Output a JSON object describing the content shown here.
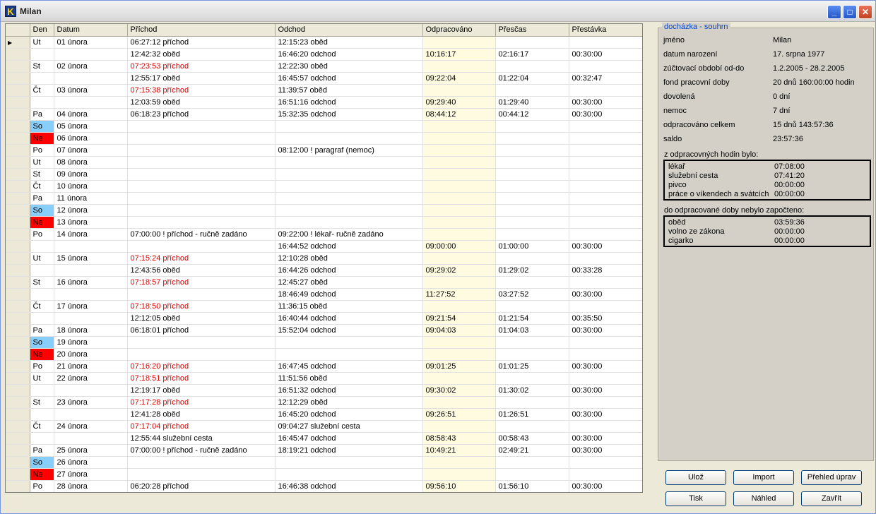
{
  "window": {
    "title": "Milan",
    "app_icon": "K",
    "minimize": "_",
    "maximize": "□",
    "close": "✕"
  },
  "grid": {
    "headers": [
      "Den",
      "Datum",
      "Příchod",
      "Odchod",
      "Odpracováno",
      "Přesčas",
      "Přestávka"
    ],
    "rows": [
      {
        "den": "Ut",
        "datum": "01 února",
        "prichod": "06:27:12 příchod",
        "odchod": "12:15:23 oběd",
        "odp": "",
        "presc": "",
        "prest": "",
        "red": false,
        "current": true
      },
      {
        "den": "",
        "datum": "",
        "prichod": "12:42:32 oběd",
        "odchod": "16:46:20 odchod",
        "odp": "10:16:17",
        "presc": "02:16:17",
        "prest": "00:30:00",
        "red": false
      },
      {
        "den": "St",
        "datum": "02 února",
        "prichod": "07:23:53 příchod",
        "odchod": "12:22:30 oběd",
        "odp": "",
        "presc": "",
        "prest": "",
        "red": true
      },
      {
        "den": "",
        "datum": "",
        "prichod": "12:55:17 oběd",
        "odchod": "16:45:57 odchod",
        "odp": "09:22:04",
        "presc": "01:22:04",
        "prest": "00:32:47",
        "red": false
      },
      {
        "den": "Čt",
        "datum": "03 února",
        "prichod": "07:15:38 příchod",
        "odchod": "11:39:57 oběd",
        "odp": "",
        "presc": "",
        "prest": "",
        "red": true
      },
      {
        "den": "",
        "datum": "",
        "prichod": "12:03:59 oběd",
        "odchod": "16:51:16 odchod",
        "odp": "09:29:40",
        "presc": "01:29:40",
        "prest": "00:30:00",
        "red": false
      },
      {
        "den": "Pa",
        "datum": "04 února",
        "prichod": "06:18:23 příchod",
        "odchod": "15:32:35 odchod",
        "odp": "08:44:12",
        "presc": "00:44:12",
        "prest": "00:30:00",
        "red": false
      },
      {
        "den": "So",
        "datum": "05 února",
        "prichod": "",
        "odchod": "",
        "odp": "",
        "presc": "",
        "prest": "",
        "red": false,
        "day": "so"
      },
      {
        "den": "Ne",
        "datum": "06 února",
        "prichod": "",
        "odchod": "",
        "odp": "",
        "presc": "",
        "prest": "",
        "red": false,
        "day": "ne"
      },
      {
        "den": "Po",
        "datum": "07 února",
        "prichod": "",
        "odchod": "08:12:00 ! paragraf (nemoc)",
        "odp": "",
        "presc": "",
        "prest": "",
        "red": false
      },
      {
        "den": "Ut",
        "datum": "08 února",
        "prichod": "",
        "odchod": "",
        "odp": "",
        "presc": "",
        "prest": "",
        "red": false
      },
      {
        "den": "St",
        "datum": "09 února",
        "prichod": "",
        "odchod": "",
        "odp": "",
        "presc": "",
        "prest": "",
        "red": false
      },
      {
        "den": "Čt",
        "datum": "10 února",
        "prichod": "",
        "odchod": "",
        "odp": "",
        "presc": "",
        "prest": "",
        "red": false
      },
      {
        "den": "Pa",
        "datum": "11 února",
        "prichod": "",
        "odchod": "",
        "odp": "",
        "presc": "",
        "prest": "",
        "red": false
      },
      {
        "den": "So",
        "datum": "12 února",
        "prichod": "",
        "odchod": "",
        "odp": "",
        "presc": "",
        "prest": "",
        "red": false,
        "day": "so"
      },
      {
        "den": "Ne",
        "datum": "13 února",
        "prichod": "",
        "odchod": "",
        "odp": "",
        "presc": "",
        "prest": "",
        "red": false,
        "day": "ne"
      },
      {
        "den": "Po",
        "datum": "14 února",
        "prichod": "07:00:00 ! příchod - ručně zadáno",
        "odchod": "09:22:00 ! lékař- ručně zadáno",
        "odp": "",
        "presc": "",
        "prest": "",
        "red": false
      },
      {
        "den": "",
        "datum": "",
        "prichod": "",
        "odchod": "16:44:52 odchod",
        "odp": "09:00:00",
        "presc": "01:00:00",
        "prest": "00:30:00",
        "red": false
      },
      {
        "den": "Ut",
        "datum": "15 února",
        "prichod": "07:15:24 příchod",
        "odchod": "12:10:28 oběd",
        "odp": "",
        "presc": "",
        "prest": "",
        "red": true
      },
      {
        "den": "",
        "datum": "",
        "prichod": "12:43:56 oběd",
        "odchod": "16:44:26 odchod",
        "odp": "09:29:02",
        "presc": "01:29:02",
        "prest": "00:33:28",
        "red": false
      },
      {
        "den": "St",
        "datum": "16 února",
        "prichod": "07:18:57 příchod",
        "odchod": "12:45:27 oběd",
        "odp": "",
        "presc": "",
        "prest": "",
        "red": true
      },
      {
        "den": "",
        "datum": "",
        "prichod": "",
        "odchod": "18:46:49 odchod",
        "odp": "11:27:52",
        "presc": "03:27:52",
        "prest": "00:30:00",
        "red": false
      },
      {
        "den": "Čt",
        "datum": "17 února",
        "prichod": "07:18:50 příchod",
        "odchod": "11:36:15 oběd",
        "odp": "",
        "presc": "",
        "prest": "",
        "red": true
      },
      {
        "den": "",
        "datum": "",
        "prichod": "12:12:05 oběd",
        "odchod": "16:40:44 odchod",
        "odp": "09:21:54",
        "presc": "01:21:54",
        "prest": "00:35:50",
        "red": false
      },
      {
        "den": "Pa",
        "datum": "18 února",
        "prichod": "06:18:01 příchod",
        "odchod": "15:52:04 odchod",
        "odp": "09:04:03",
        "presc": "01:04:03",
        "prest": "00:30:00",
        "red": false
      },
      {
        "den": "So",
        "datum": "19 února",
        "prichod": "",
        "odchod": "",
        "odp": "",
        "presc": "",
        "prest": "",
        "red": false,
        "day": "so"
      },
      {
        "den": "Ne",
        "datum": "20 února",
        "prichod": "",
        "odchod": "",
        "odp": "",
        "presc": "",
        "prest": "",
        "red": false,
        "day": "ne"
      },
      {
        "den": "Po",
        "datum": "21 února",
        "prichod": "07:16:20 příchod",
        "odchod": "16:47:45 odchod",
        "odp": "09:01:25",
        "presc": "01:01:25",
        "prest": "00:30:00",
        "red": true
      },
      {
        "den": "Ut",
        "datum": "22 února",
        "prichod": "07:18:51 příchod",
        "odchod": "11:51:56 oběd",
        "odp": "",
        "presc": "",
        "prest": "",
        "red": true
      },
      {
        "den": "",
        "datum": "",
        "prichod": "12:19:17 oběd",
        "odchod": "16:51:32 odchod",
        "odp": "09:30:02",
        "presc": "01:30:02",
        "prest": "00:30:00",
        "red": false
      },
      {
        "den": "St",
        "datum": "23 února",
        "prichod": "07:17:28 příchod",
        "odchod": "12:12:29 oběd",
        "odp": "",
        "presc": "",
        "prest": "",
        "red": true
      },
      {
        "den": "",
        "datum": "",
        "prichod": "12:41:28 oběd",
        "odchod": "16:45:20 odchod",
        "odp": "09:26:51",
        "presc": "01:26:51",
        "prest": "00:30:00",
        "red": false
      },
      {
        "den": "Čt",
        "datum": "24 února",
        "prichod": "07:17:04 příchod",
        "odchod": "09:04:27 služební cesta",
        "odp": "",
        "presc": "",
        "prest": "",
        "red": true
      },
      {
        "den": "",
        "datum": "",
        "prichod": "12:55:44 služební cesta",
        "odchod": "16:45:47 odchod",
        "odp": "08:58:43",
        "presc": "00:58:43",
        "prest": "00:30:00",
        "red": false
      },
      {
        "den": "Pa",
        "datum": "25 února",
        "prichod": "07:00:00 ! příchod - ručně zadáno",
        "odchod": "18:19:21 odchod",
        "odp": "10:49:21",
        "presc": "02:49:21",
        "prest": "00:30:00",
        "red": false
      },
      {
        "den": "So",
        "datum": "26 února",
        "prichod": "",
        "odchod": "",
        "odp": "",
        "presc": "",
        "prest": "",
        "red": false,
        "day": "so"
      },
      {
        "den": "Ne",
        "datum": "27 února",
        "prichod": "",
        "odchod": "",
        "odp": "",
        "presc": "",
        "prest": "",
        "red": false,
        "day": "ne"
      },
      {
        "den": "Po",
        "datum": "28 února",
        "prichod": "06:20:28 příchod",
        "odchod": "16:46:38 odchod",
        "odp": "09:56:10",
        "presc": "01:56:10",
        "prest": "00:30:00",
        "red": false
      }
    ]
  },
  "summary": {
    "legend": "docházka - souhrn",
    "fields": [
      {
        "label": "jméno",
        "value": "Milan"
      },
      {
        "label": "datum narození",
        "value": "17. srpna 1977"
      },
      {
        "label": "zúčtovací období od-do",
        "value": "1.2.2005 - 28.2.2005"
      },
      {
        "label": "fond pracovní doby",
        "value": "20 dnů 160:00:00 hodin"
      },
      {
        "label": "dovolená",
        "value": "0 dní"
      },
      {
        "label": "nemoc",
        "value": "7 dní"
      },
      {
        "label": "odpracováno celkem",
        "value": "15 dnů 143:57:36"
      },
      {
        "label": "saldo",
        "value": "23:57:36"
      }
    ],
    "worked_label": "z odpracovných hodin bylo:",
    "worked": [
      {
        "label": "lékař",
        "value": "07:08:00"
      },
      {
        "label": "služební cesta",
        "value": "07:41:20"
      },
      {
        "label": "pivco",
        "value": "00:00:00"
      },
      {
        "label": "práce o víkendech a svátcích",
        "value": "00:00:00"
      }
    ],
    "not_counted_label": "do odpracované doby nebylo započteno:",
    "not_counted": [
      {
        "label": "oběd",
        "value": "03:59:36"
      },
      {
        "label": "volno ze zákona",
        "value": "00:00:00"
      },
      {
        "label": "cigarko",
        "value": "00:00:00"
      }
    ]
  },
  "buttons": {
    "uloz": "Ulož",
    "import": "Import",
    "prehled": "Přehled úprav",
    "tisk": "Tisk",
    "nahled": "Náhled",
    "zavrit": "Zavřít"
  }
}
